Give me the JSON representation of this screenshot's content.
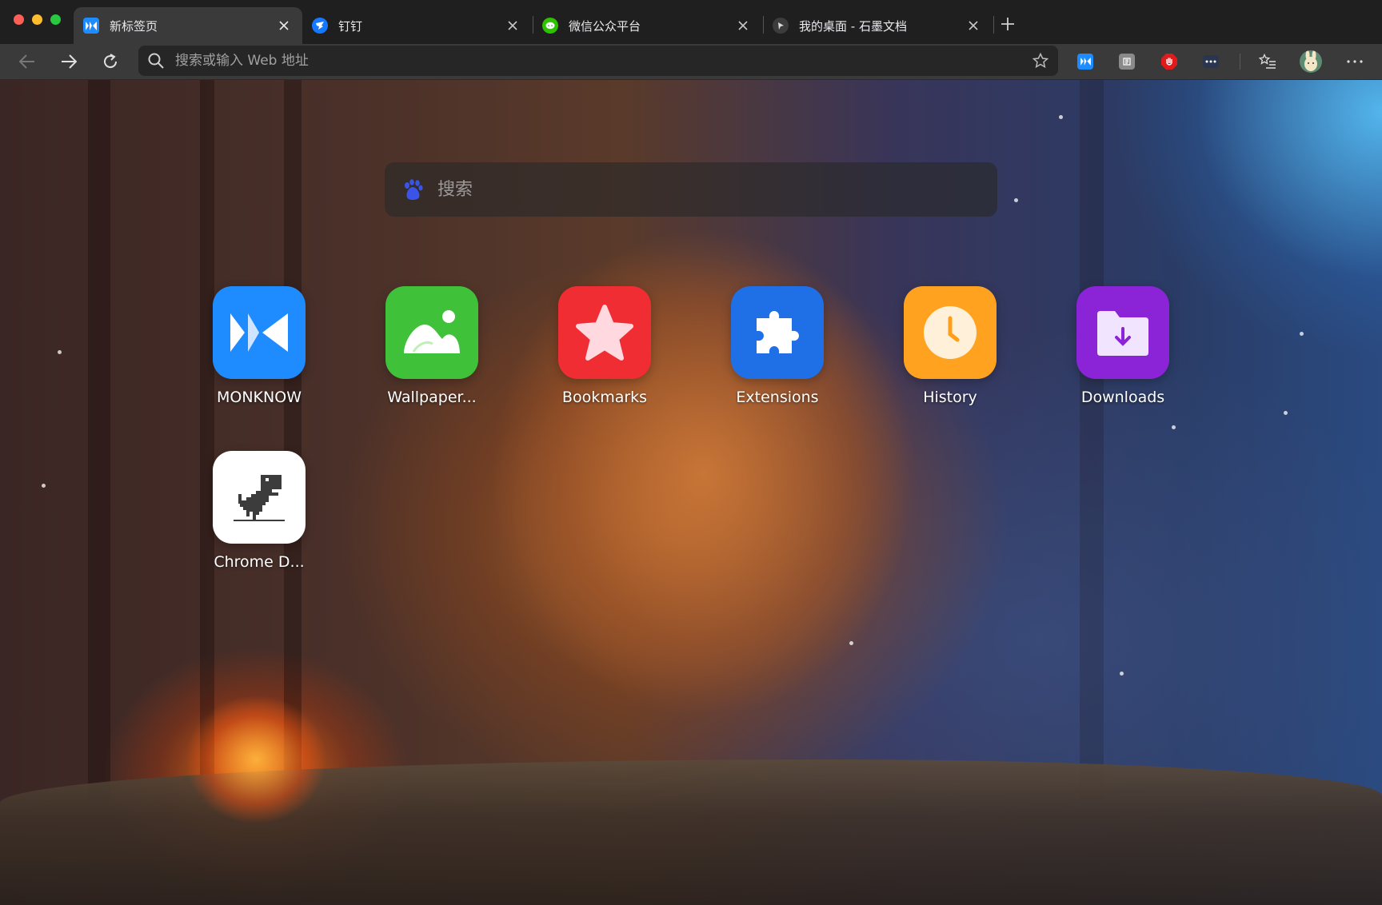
{
  "tabs": [
    {
      "title": "新标签页",
      "favicon": "monknow-icon",
      "active": true
    },
    {
      "title": "钉钉",
      "favicon": "dingtalk-icon",
      "active": false
    },
    {
      "title": "微信公众平台",
      "favicon": "wechat-icon",
      "active": false
    },
    {
      "title": "我的桌面 - 石墨文档",
      "favicon": "shimo-icon",
      "active": false
    }
  ],
  "toolbar": {
    "address_placeholder": "搜索或输入 Web 地址",
    "extensions": [
      "monknow-ext-icon",
      "notebook-ext-icon",
      "adblock-ext-icon",
      "password-ext-icon"
    ]
  },
  "search": {
    "placeholder": "搜索",
    "engine_icon": "baidu-icon"
  },
  "shortcuts": [
    {
      "label": "MONKNOW",
      "color": "#1e8cff",
      "icon": "monknow-icon"
    },
    {
      "label": "Wallpaper...",
      "color": "#3fc13a",
      "icon": "wallpaper-icon"
    },
    {
      "label": "Bookmarks",
      "color": "#ef2d32",
      "icon": "star-icon"
    },
    {
      "label": "Extensions",
      "color": "#1f6fe6",
      "icon": "puzzle-icon"
    },
    {
      "label": "History",
      "color": "#ffa21f",
      "icon": "clock-icon"
    },
    {
      "label": "Downloads",
      "color": "#8a24d6",
      "icon": "download-folder-icon"
    },
    {
      "label": "Chrome D...",
      "color": "#ffffff",
      "icon": "dino-icon"
    }
  ]
}
